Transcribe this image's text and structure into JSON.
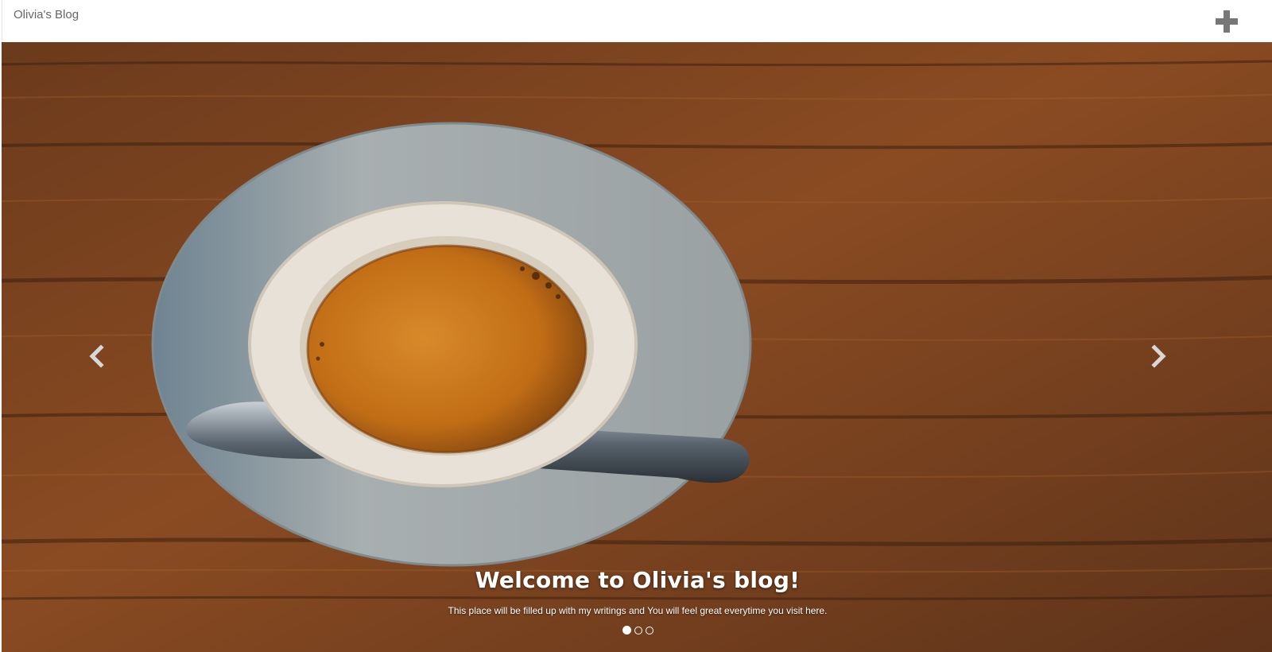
{
  "navbar": {
    "brand": "Olivia's Blog",
    "add_icon": "plus-icon"
  },
  "carousel": {
    "prev_icon": "chevron-left-icon",
    "next_icon": "chevron-right-icon",
    "slide": {
      "title": "Welcome to Olivia's blog!",
      "text": "This place will be filled up with my writings and You will feel great everytime you visit here.",
      "image": "coffee-cup-on-wooden-table"
    },
    "indicators": [
      {
        "active": true
      },
      {
        "active": false
      },
      {
        "active": false
      }
    ]
  },
  "colors": {
    "wood": "#7a4321",
    "wood_dark": "#4a2a14",
    "saucer": "#9ea6a8",
    "cup": "#ece7df",
    "coffee": "#c9741c",
    "brand_text": "#666666",
    "icon_gray": "#777777"
  }
}
